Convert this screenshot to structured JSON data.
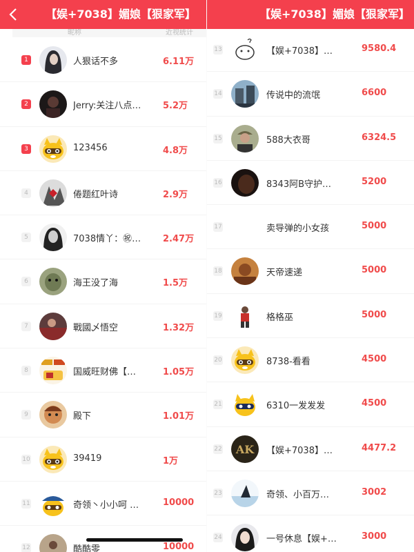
{
  "left": {
    "title": "【娱+7038】媚娘【狠家军】",
    "col_left": "昵称",
    "col_right": "近视统计",
    "rows": [
      {
        "rank": "1",
        "name": "人狠话不多",
        "value": "6.11万",
        "avatar": "dark-hair-avatar"
      },
      {
        "rank": "2",
        "name": "Jerry:关注八点…",
        "value": "5.2万",
        "avatar": "dark-photo-avatar"
      },
      {
        "rank": "3",
        "name": "123456",
        "value": "4.8万",
        "avatar": "yellow-mascot-avatar"
      },
      {
        "rank": "4",
        "name": "倦题红叶诗",
        "value": "2.9万",
        "avatar": "red-leaf-avatar"
      },
      {
        "rank": "5",
        "name": "7038情丫：㊗…",
        "value": "2.47万",
        "avatar": "bw-portrait-avatar"
      },
      {
        "rank": "6",
        "name": "海王没了海",
        "value": "1.5万",
        "avatar": "green-face-avatar"
      },
      {
        "rank": "7",
        "name": "戰國乄悟空",
        "value": "1.32万",
        "avatar": "red-scene-avatar"
      },
      {
        "rank": "8",
        "name": "国威旺财佛【…",
        "value": "1.05万",
        "avatar": "badge-avatar"
      },
      {
        "rank": "9",
        "name": "殿下",
        "value": "1.01万",
        "avatar": "cartoon-kid-avatar"
      },
      {
        "rank": "10",
        "name": "39419",
        "value": "1万",
        "avatar": "yellow-mascot-avatar"
      },
      {
        "rank": "11",
        "name": "奇领丶小小呵 …",
        "value": "10000",
        "avatar": "mascot-hat-avatar"
      },
      {
        "rank": "12",
        "name": "酷酷零",
        "value": "10000",
        "avatar": "street-avatar"
      }
    ]
  },
  "right": {
    "title": "【娱+7038】媚娘【狠家军】",
    "rows": [
      {
        "rank": "13",
        "name": "【娱+7038】…",
        "value": "9580.4",
        "avatar": "doodle-avatar"
      },
      {
        "rank": "14",
        "name": "传说中的流氓",
        "value": "6600",
        "avatar": "building-avatar"
      },
      {
        "rank": "15",
        "name": "588大衣哥",
        "value": "6324.5",
        "avatar": "man-cap-avatar"
      },
      {
        "rank": "16",
        "name": "8343阿B守护…",
        "value": "5200",
        "avatar": "dark-face-avatar"
      },
      {
        "rank": "17",
        "name": "卖导弹的小女孩",
        "value": "5000",
        "avatar": "none"
      },
      {
        "rank": "18",
        "name": "天帝速递",
        "value": "5000",
        "avatar": "warm-avatar"
      },
      {
        "rank": "19",
        "name": "格格巫",
        "value": "5000",
        "avatar": "figure-avatar"
      },
      {
        "rank": "20",
        "name": "8738-看看",
        "value": "4500",
        "avatar": "yellow-mascot-avatar"
      },
      {
        "rank": "21",
        "name": "6310一发发发",
        "value": "4500",
        "avatar": "mascot-alt-avatar"
      },
      {
        "rank": "22",
        "name": "【娱+7038】…",
        "value": "4477.2",
        "avatar": "ak-logo-avatar"
      },
      {
        "rank": "23",
        "name": "奇领、小百万…",
        "value": "3002",
        "avatar": "shark-fin-avatar"
      },
      {
        "rank": "24",
        "name": "一号休息【娱+…",
        "value": "3000",
        "avatar": "portrait-avatar"
      }
    ]
  },
  "ak_text": "AK",
  "colors": {
    "header": "#f4404d",
    "value": "#f04b4b",
    "rank_top": "#f4404d"
  }
}
